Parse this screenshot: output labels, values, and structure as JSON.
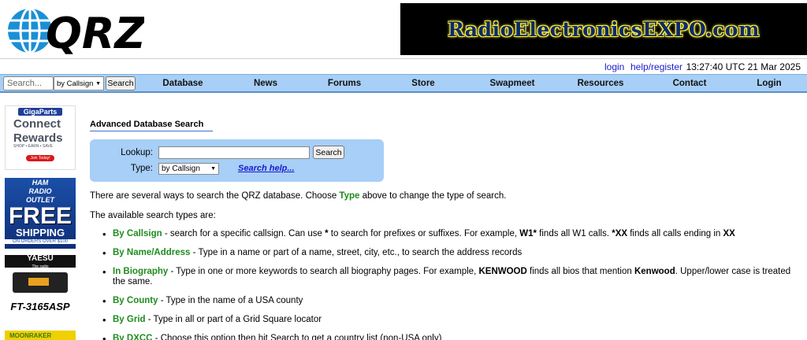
{
  "header": {
    "logo_text": "QRZ",
    "banner_text": "RadioElectronicsEXPO.com"
  },
  "topbar": {
    "login": "login",
    "help_register": "help/register",
    "time": "13:27:40 UTC 21 Mar 2025"
  },
  "nav": {
    "search_placeholder": "Search...",
    "search_type": "by Callsign",
    "search_button": "Search",
    "items": [
      "Database",
      "News",
      "Forums",
      "Store",
      "Swapmeet",
      "Resources",
      "Contact",
      "Login"
    ]
  },
  "ads": {
    "gigaparts": {
      "brand": "GigaParts",
      "line1": "Connect",
      "line2": "Rewards",
      "sub": "SHOP • EARN • SAVE",
      "cta": "Join Today!"
    },
    "hamradio": {
      "line1": "HAM",
      "line2": "RADIO",
      "line3": "OUTLET",
      "free": "FREE",
      "shipping": "SHIPPING",
      "orders": "ON ORDERS OVER $100"
    },
    "yaesu": {
      "brand": "YAESU",
      "tagline": "The radio",
      "model": "FT-3165ASP"
    },
    "moonraker": {
      "brand": "MOONRAKER"
    }
  },
  "main": {
    "title": "Advanced Database Search",
    "lookup_label": "Lookup:",
    "lookup_value": "",
    "search_button": "Search",
    "type_label": "Type:",
    "type_value": "by Callsign",
    "search_help": "Search help...",
    "intro_pre": "There are several ways to search the QRZ database. Choose ",
    "intro_type": "Type",
    "intro_post": " above to change the type of search.",
    "available": "The available search types are:",
    "types": [
      {
        "name": "By Callsign",
        "desc_parts": [
          " - search for a specific callsign. Can use ",
          "*",
          " to search for prefixes or suffixes. For example, ",
          "W1*",
          " finds all W1 calls. ",
          "*XX",
          " finds all calls ending in ",
          "XX"
        ]
      },
      {
        "name": "By Name/Address",
        "desc": " - Type in a name or part of a name, street, city, etc., to search the address records"
      },
      {
        "name": "In Biography",
        "desc_parts": [
          " - Type in one or more keywords to search all biography pages. For example, ",
          "KENWOOD",
          " finds all bios that mention ",
          "Kenwood",
          ". Upper/lower case is treated the same."
        ]
      },
      {
        "name": "By County",
        "desc": " - Type in the name of a USA county"
      },
      {
        "name": "By Grid",
        "desc": " - Type in all or part of a Grid Square locator"
      },
      {
        "name": "By DXCC",
        "desc": " - Choose this option then hit Search to get a country list (non-USA only)"
      }
    ]
  }
}
